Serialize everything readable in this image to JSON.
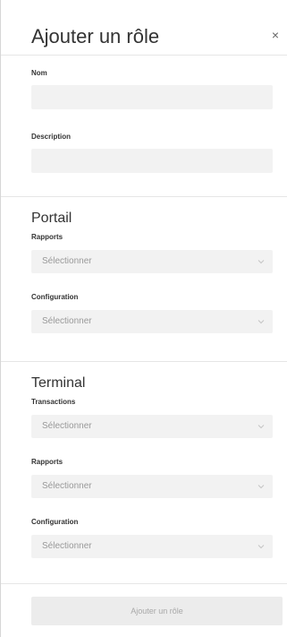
{
  "dialog": {
    "title": "Ajouter un rôle",
    "close_label": "×"
  },
  "general": {
    "name_label": "Nom",
    "name_value": "",
    "description_label": "Description",
    "description_value": ""
  },
  "portail": {
    "title": "Portail",
    "fields": [
      {
        "label": "Rapports",
        "placeholder": "Sélectionner"
      },
      {
        "label": "Configuration",
        "placeholder": "Sélectionner"
      }
    ]
  },
  "terminal": {
    "title": "Terminal",
    "fields": [
      {
        "label": "Transactions",
        "placeholder": "Sélectionner"
      },
      {
        "label": "Rapports",
        "placeholder": "Sélectionner"
      },
      {
        "label": "Configuration",
        "placeholder": "Sélectionner"
      }
    ]
  },
  "footer": {
    "submit_label": "Ajouter un rôle",
    "submit_enabled": false
  },
  "colors": {
    "input_bg": "#f2f2f2",
    "placeholder": "#999999",
    "button_bg_disabled": "#ececec",
    "button_text_disabled": "#a8a8a8"
  },
  "icons": {
    "close": "close-icon",
    "select_caret": "chevron-down-icon"
  }
}
